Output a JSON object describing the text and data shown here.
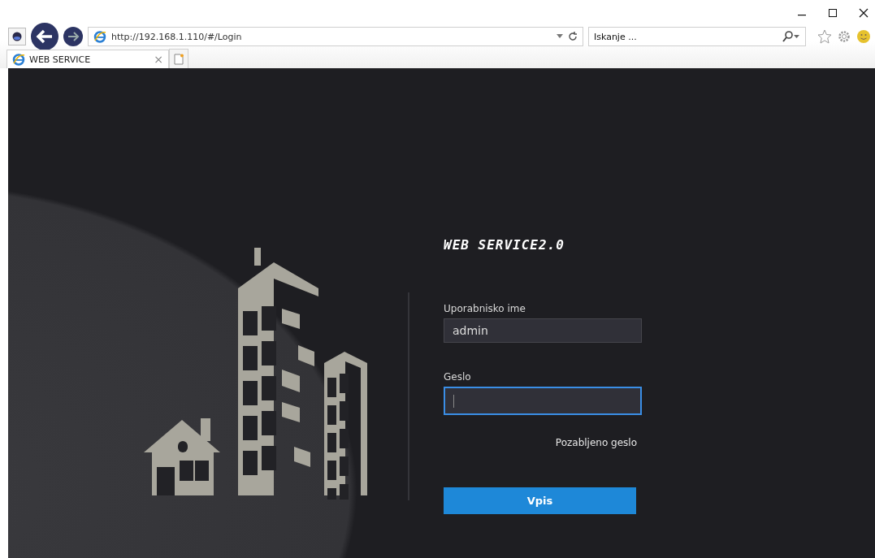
{
  "browser": {
    "address": "http://192.168.1.110/#/Login",
    "search_placeholder": "Iskanje ...",
    "tabs": [
      {
        "label": "WEB SERVICE",
        "selected": true,
        "close": "×"
      }
    ]
  },
  "login": {
    "title": "WEB SERVICE2.0",
    "fields": [
      {
        "label": "Uporabnisko ime",
        "value": "admin",
        "focused": false
      },
      {
        "label": "Geslo",
        "focused": true
      }
    ],
    "forgot_link": "Pozabljeno geslo",
    "submit": "Vpis"
  }
}
